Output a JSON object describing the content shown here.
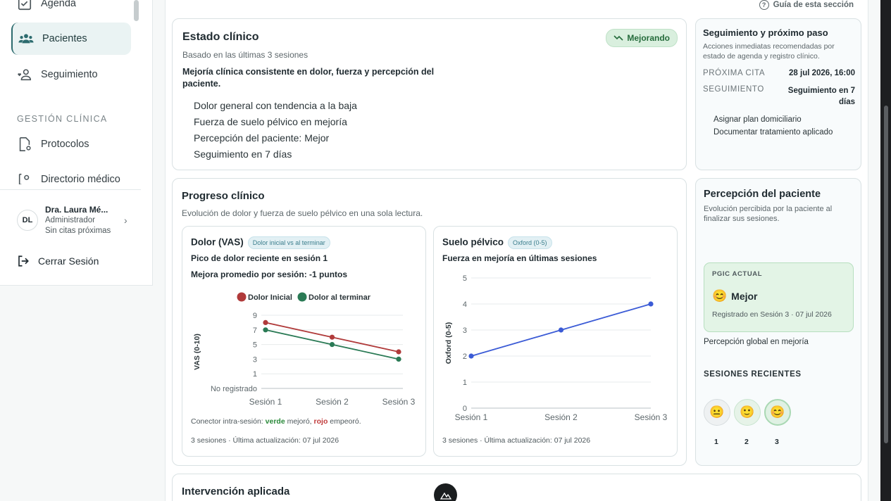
{
  "sidebar": {
    "items": [
      {
        "label": "Agenda"
      },
      {
        "label": "Pacientes"
      },
      {
        "label": "Seguimiento"
      },
      {
        "label": "Protocolos"
      },
      {
        "label": "Directorio médico"
      }
    ],
    "section_label": "GESTIÓN CLÍNICA",
    "user": {
      "initials": "DL",
      "name": "Dra. Laura Mé...",
      "role": "Administrador",
      "status": "Sin citas próximas"
    },
    "logout_label": "Cerrar Sesión"
  },
  "guide_label": "Guía de esta sección",
  "clinical_state": {
    "title": "Estado clínico",
    "badge": "Mejorando",
    "subtitle": "Basado en las últimas 3 sesiones",
    "summary": "Mejoría clínica consistente en dolor, fuerza y percepción del paciente.",
    "bullets": [
      "Dolor general con tendencia a la baja",
      "Fuerza de suelo pélvico en mejoría",
      "Percepción del paciente: Mejor",
      "Seguimiento en 7 días"
    ]
  },
  "followup": {
    "title": "Seguimiento y próximo paso",
    "subtitle": "Acciones inmediatas recomendadas por estado de agenda y registro clínico.",
    "next_label": "PRÓXIMA CITA",
    "next_value": "28 jul 2026, 16:00",
    "follow_label": "SEGUIMIENTO",
    "follow_value": "Seguimiento en 7 días",
    "actions": [
      "Asignar plan domiciliario",
      "Documentar tratamiento aplicado"
    ]
  },
  "progress": {
    "title": "Progreso clínico",
    "subtitle": "Evolución de dolor y fuerza de suelo pélvico en una sola lectura.",
    "pain": {
      "title": "Dolor (VAS)",
      "chip": "Dolor inicial vs al terminar",
      "line1": "Pico de dolor reciente en sesión 1",
      "line2": "Mejora promedio por sesión: -1 puntos",
      "note_pre": "Conector intra-sesión: ",
      "note_green": "verde",
      "note_mid": " mejoró, ",
      "note_red": "rojo",
      "note_post": " empeoró.",
      "footer": "3 sesiones · Última actualización: 07 jul 2026"
    },
    "pelvic": {
      "title": "Suelo pélvico",
      "chip": "Oxford (0-5)",
      "line1": "Fuerza en mejoría en últimas sesiones",
      "footer": "3 sesiones · Última actualización: 07 jul 2026"
    }
  },
  "perception": {
    "title": "Percepción del paciente",
    "subtitle": "Evolución percibida por la paciente al finalizar sus sesiones.",
    "pgic_label": "PGIC ACTUAL",
    "pgic_value": "Mejor",
    "pgic_note": "Registrado en Sesión 3 · 07 jul 2026",
    "global_note": "Percepción global en mejoría",
    "recent_label": "SESIONES RECIENTES",
    "sessions": [
      "1",
      "2",
      "3"
    ]
  },
  "intervention": {
    "title": "Intervención aplicada"
  },
  "chart_data": [
    {
      "type": "line",
      "categories": [
        "Sesión 1",
        "Sesión 2",
        "Sesión 3"
      ],
      "series": [
        {
          "name": "Dolor Inicial",
          "values": [
            8,
            6,
            4
          ],
          "color": "#b03a3a"
        },
        {
          "name": "Dolor al terminar",
          "values": [
            7,
            5,
            3
          ],
          "color": "#2a7a55"
        }
      ],
      "ylabel": "VAS (0-10)",
      "yticks": [
        "No registrado",
        "1",
        "3",
        "5",
        "7",
        "9"
      ],
      "ylim": [
        -1,
        9
      ],
      "legend": "top"
    },
    {
      "type": "line",
      "categories": [
        "Sesión 1",
        "Sesión 2",
        "Sesión 3"
      ],
      "series": [
        {
          "values": [
            2,
            3,
            4
          ],
          "color": "#3b5bd6"
        }
      ],
      "ylabel": "Oxford (0-5)",
      "yticks": [
        "0",
        "1",
        "2",
        "3",
        "4",
        "5"
      ],
      "ylim": [
        0,
        5
      ]
    }
  ]
}
